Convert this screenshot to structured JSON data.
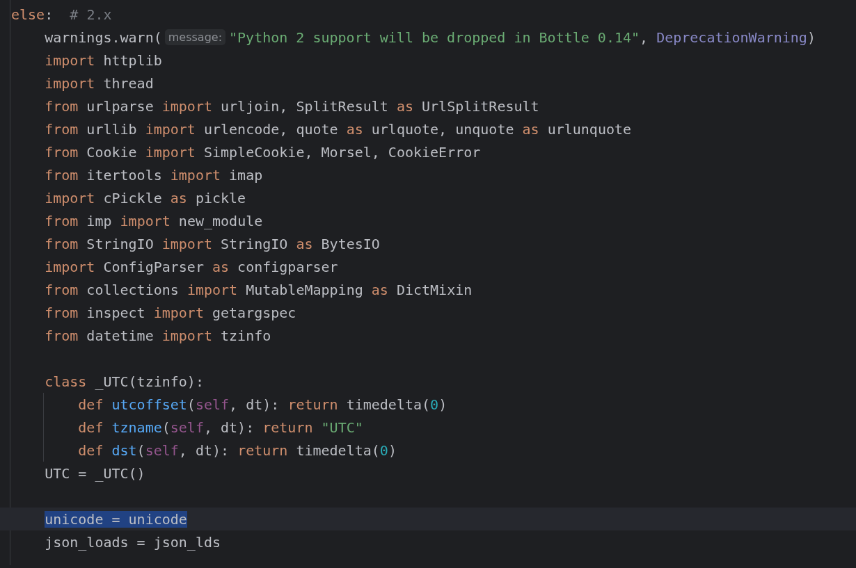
{
  "editor": {
    "lines": [
      {
        "selected": false,
        "tokens": [
          {
            "kind": "keyword",
            "text": "else"
          },
          {
            "kind": "plain",
            "text": ":  "
          },
          {
            "kind": "comment",
            "text": "# 2.x"
          }
        ],
        "children": [
          {
            "selected": false,
            "tokens": [
              {
                "kind": "plain",
                "text": "warnings.warn("
              },
              {
                "kind": "hint",
                "text": "message:"
              },
              {
                "kind": "string",
                "text": "\"Python 2 support will be dropped in Bottle 0.14\""
              },
              {
                "kind": "plain",
                "text": ", "
              },
              {
                "kind": "builtin",
                "text": "DeprecationWarning"
              },
              {
                "kind": "plain",
                "text": ")"
              }
            ]
          },
          {
            "selected": false,
            "tokens": [
              {
                "kind": "keyword",
                "text": "import"
              },
              {
                "kind": "plain",
                "text": " httplib"
              }
            ]
          },
          {
            "selected": false,
            "tokens": [
              {
                "kind": "keyword",
                "text": "import"
              },
              {
                "kind": "plain",
                "text": " thread"
              }
            ]
          },
          {
            "selected": false,
            "tokens": [
              {
                "kind": "keyword",
                "text": "from"
              },
              {
                "kind": "plain",
                "text": " urlparse "
              },
              {
                "kind": "keyword",
                "text": "import"
              },
              {
                "kind": "plain",
                "text": " urljoin, SplitResult "
              },
              {
                "kind": "keyword",
                "text": "as"
              },
              {
                "kind": "plain",
                "text": " UrlSplitResult"
              }
            ]
          },
          {
            "selected": false,
            "tokens": [
              {
                "kind": "keyword",
                "text": "from"
              },
              {
                "kind": "plain",
                "text": " urllib "
              },
              {
                "kind": "keyword",
                "text": "import"
              },
              {
                "kind": "plain",
                "text": " urlencode, quote "
              },
              {
                "kind": "keyword",
                "text": "as"
              },
              {
                "kind": "plain",
                "text": " urlquote, unquote "
              },
              {
                "kind": "keyword",
                "text": "as"
              },
              {
                "kind": "plain",
                "text": " urlunquote"
              }
            ]
          },
          {
            "selected": false,
            "tokens": [
              {
                "kind": "keyword",
                "text": "from"
              },
              {
                "kind": "plain",
                "text": " Cookie "
              },
              {
                "kind": "keyword",
                "text": "import"
              },
              {
                "kind": "plain",
                "text": " SimpleCookie, Morsel, CookieError"
              }
            ]
          },
          {
            "selected": false,
            "tokens": [
              {
                "kind": "keyword",
                "text": "from"
              },
              {
                "kind": "plain",
                "text": " itertools "
              },
              {
                "kind": "keyword",
                "text": "import"
              },
              {
                "kind": "plain",
                "text": " imap"
              }
            ]
          },
          {
            "selected": false,
            "tokens": [
              {
                "kind": "keyword",
                "text": "import"
              },
              {
                "kind": "plain",
                "text": " cPickle "
              },
              {
                "kind": "keyword",
                "text": "as"
              },
              {
                "kind": "plain",
                "text": " pickle"
              }
            ]
          },
          {
            "selected": false,
            "tokens": [
              {
                "kind": "keyword",
                "text": "from"
              },
              {
                "kind": "plain",
                "text": " imp "
              },
              {
                "kind": "keyword",
                "text": "import"
              },
              {
                "kind": "plain",
                "text": " new_module"
              }
            ]
          },
          {
            "selected": false,
            "tokens": [
              {
                "kind": "keyword",
                "text": "from"
              },
              {
                "kind": "plain",
                "text": " StringIO "
              },
              {
                "kind": "keyword",
                "text": "import"
              },
              {
                "kind": "plain",
                "text": " StringIO "
              },
              {
                "kind": "keyword",
                "text": "as"
              },
              {
                "kind": "plain",
                "text": " BytesIO"
              }
            ]
          },
          {
            "selected": false,
            "tokens": [
              {
                "kind": "keyword",
                "text": "import"
              },
              {
                "kind": "plain",
                "text": " ConfigParser "
              },
              {
                "kind": "keyword",
                "text": "as"
              },
              {
                "kind": "plain",
                "text": " configparser"
              }
            ]
          },
          {
            "selected": false,
            "tokens": [
              {
                "kind": "keyword",
                "text": "from"
              },
              {
                "kind": "plain",
                "text": " collections "
              },
              {
                "kind": "keyword",
                "text": "import"
              },
              {
                "kind": "plain",
                "text": " MutableMapping "
              },
              {
                "kind": "keyword",
                "text": "as"
              },
              {
                "kind": "plain",
                "text": " DictMixin"
              }
            ]
          },
          {
            "selected": false,
            "tokens": [
              {
                "kind": "keyword",
                "text": "from"
              },
              {
                "kind": "plain",
                "text": " inspect "
              },
              {
                "kind": "keyword",
                "text": "import"
              },
              {
                "kind": "plain",
                "text": " getargspec"
              }
            ]
          },
          {
            "selected": false,
            "tokens": [
              {
                "kind": "keyword",
                "text": "from"
              },
              {
                "kind": "plain",
                "text": " datetime "
              },
              {
                "kind": "keyword",
                "text": "import"
              },
              {
                "kind": "plain",
                "text": " tzinfo"
              }
            ]
          },
          {
            "selected": false
          },
          {
            "selected": false,
            "tokens": [
              {
                "kind": "keyword",
                "text": "class"
              },
              {
                "kind": "plain",
                "text": " _UTC(tzinfo):"
              }
            ],
            "children": [
              {
                "selected": false,
                "tokens": [
                  {
                    "kind": "keyword",
                    "text": "def "
                  },
                  {
                    "kind": "function",
                    "text": "utcoffset"
                  },
                  {
                    "kind": "plain",
                    "text": "("
                  },
                  {
                    "kind": "self",
                    "text": "self"
                  },
                  {
                    "kind": "plain",
                    "text": ", dt): "
                  },
                  {
                    "kind": "keyword",
                    "text": "return"
                  },
                  {
                    "kind": "plain",
                    "text": " timedelta("
                  },
                  {
                    "kind": "number",
                    "text": "0"
                  },
                  {
                    "kind": "plain",
                    "text": ")"
                  }
                ]
              },
              {
                "selected": false,
                "tokens": [
                  {
                    "kind": "keyword",
                    "text": "def "
                  },
                  {
                    "kind": "function",
                    "text": "tzname"
                  },
                  {
                    "kind": "plain",
                    "text": "("
                  },
                  {
                    "kind": "self",
                    "text": "self"
                  },
                  {
                    "kind": "plain",
                    "text": ", dt): "
                  },
                  {
                    "kind": "keyword",
                    "text": "return "
                  },
                  {
                    "kind": "string",
                    "text": "\"UTC\""
                  }
                ]
              },
              {
                "selected": false,
                "tokens": [
                  {
                    "kind": "keyword",
                    "text": "def "
                  },
                  {
                    "kind": "function",
                    "text": "dst"
                  },
                  {
                    "kind": "plain",
                    "text": "("
                  },
                  {
                    "kind": "self",
                    "text": "self"
                  },
                  {
                    "kind": "plain",
                    "text": ", dt): "
                  },
                  {
                    "kind": "keyword",
                    "text": "return"
                  },
                  {
                    "kind": "plain",
                    "text": " timedelta("
                  },
                  {
                    "kind": "number",
                    "text": "0"
                  },
                  {
                    "kind": "plain",
                    "text": ")"
                  }
                ]
              }
            ]
          },
          {
            "selected": false,
            "tokens": [
              {
                "kind": "plain",
                "text": "UTC = _UTC()"
              }
            ]
          },
          {
            "selected": false
          },
          {
            "selected": true,
            "tokens": [
              {
                "kind": "plain",
                "text": "unicode = unicode"
              }
            ]
          },
          {
            "selected": false,
            "tokens": [
              {
                "kind": "plain",
                "text": "json_loads = json_lds"
              }
            ]
          }
        ]
      }
    ]
  }
}
